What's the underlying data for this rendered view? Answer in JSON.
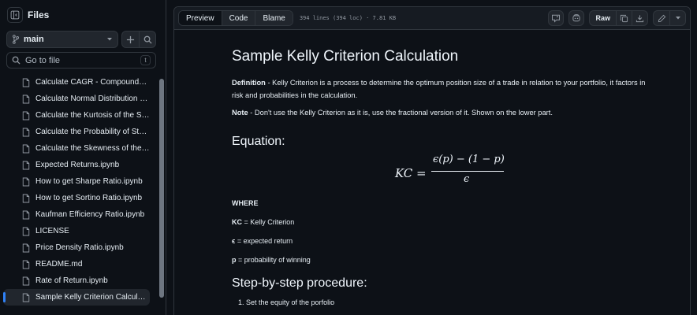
{
  "sidebar": {
    "title": "Files",
    "branch": "main",
    "goto_placeholder": "Go to file",
    "goto_shortcut": "t",
    "items": [
      {
        "label": "Calculate CAGR - Compounded A..."
      },
      {
        "label": "Calculate Normal Distribution of ..."
      },
      {
        "label": "Calculate the Kurtosis of the Stoc..."
      },
      {
        "label": "Calculate the Probability of Stock..."
      },
      {
        "label": "Calculate the Skewness of the St..."
      },
      {
        "label": "Expected Returns.ipynb"
      },
      {
        "label": "How to get Sharpe Ratio.ipynb"
      },
      {
        "label": "How to get Sortino Ratio.ipynb"
      },
      {
        "label": "Kaufman Efficiency Ratio.ipynb"
      },
      {
        "label": "LICENSE"
      },
      {
        "label": "Price Density Ratio.ipynb"
      },
      {
        "label": "README.md"
      },
      {
        "label": "Rate of Return.ipynb"
      },
      {
        "label": "Sample Kelly Criterion Calculatio..."
      }
    ],
    "active_index": 13
  },
  "toolbar": {
    "tabs": [
      "Preview",
      "Code",
      "Blame"
    ],
    "active_tab": "Preview",
    "file_info": "394 lines (394 loc) · 7.81 KB",
    "raw_label": "Raw"
  },
  "doc": {
    "title": "Sample Kelly Criterion Calculation",
    "definition_label": "Definition",
    "definition_text": " - Kelly Criterion is a process to determine the optimum position size of a trade in relation to your portfolio, it factors in risk and probabilities in the calculation.",
    "note_label": "Note",
    "note_text": " - Don't use the Kelly Criterion as it is, use the fractional version of it. Shown on the lower part.",
    "equation_heading": "Equation:",
    "formula_lhs": "KC =",
    "formula_num": "ϵ(p) − (1 − p)",
    "formula_den": "ϵ",
    "where_label": "WHERE",
    "kc_label": "KC",
    "kc_text": " = Kelly Criterion",
    "e_label": "ϵ",
    "e_text": " = expected return",
    "p_label": "p",
    "p_text": " = probability of winning",
    "steps_heading": "Step-by-step procedure:",
    "steps": [
      "Set the equity of the porfolio"
    ]
  }
}
